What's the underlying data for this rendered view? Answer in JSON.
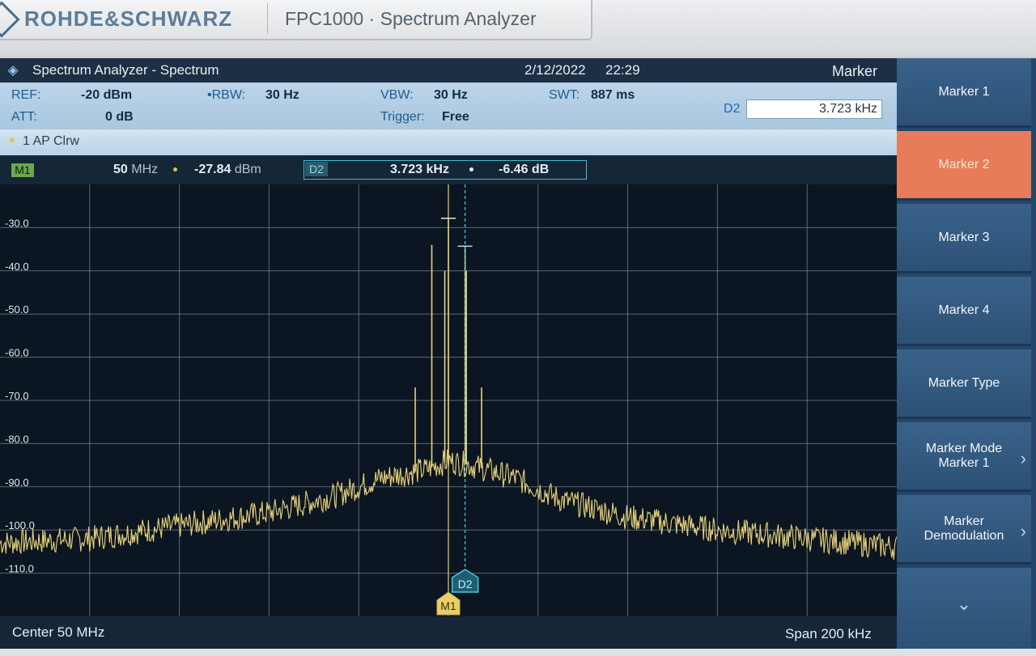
{
  "brand": {
    "name": "ROHDE&SCHWARZ",
    "model": "FPC1000 · Spectrum Analyzer"
  },
  "title_bar": {
    "icon": "rs-logo-icon",
    "title": "Spectrum Analyzer - Spectrum",
    "date": "2/12/2022",
    "time": "22:29",
    "right_title": "Marker"
  },
  "params": {
    "ref_label": "REF:",
    "ref_value": "-20 dBm",
    "att_label": "ATT:",
    "att_value": "0 dB",
    "rbw_label": "•RBW:",
    "rbw_value": "30 Hz",
    "vbw_label": "VBW:",
    "vbw_value": "30 Hz",
    "trigger_label": "Trigger:",
    "trigger_value": "Free",
    "swt_label": "SWT:",
    "swt_value": "887 ms",
    "d2_label": "D2",
    "d2_input": "3.723 kHz"
  },
  "trace": {
    "label": "1 AP Clrw"
  },
  "markers": {
    "m1_tag": "M1",
    "m1_freq": "50",
    "m1_freq_unit": "MHz",
    "m1_level": "-27.84",
    "m1_level_unit": "dBm",
    "d2_tag": "D2",
    "d2_freq": "3.723 kHz",
    "d2_level": "-6.46 dB"
  },
  "plot": {
    "y_ticks": [
      "-30.0",
      "-40.0",
      "-50.0",
      "-60.0",
      "-70.0",
      "-80.0",
      "-90.0",
      "-100.0",
      "-110.0"
    ],
    "y_values": [
      -30,
      -40,
      -50,
      -60,
      -70,
      -80,
      -90,
      -100,
      -110
    ],
    "ylim": [
      -120,
      -20
    ],
    "xlim": [
      -100,
      100
    ],
    "trace_color": "#e9d27a",
    "grid_color": "#7e8a96",
    "marker_m1": {
      "label": "M1",
      "x": 0,
      "y": -27.84,
      "color": "#e8cf6a"
    },
    "marker_d2": {
      "label": "D2",
      "x": 3.723,
      "y": -34.3,
      "color": "#4cc9dc"
    },
    "spurs": [
      {
        "x": -3.7,
        "y": -34
      },
      {
        "x": 0,
        "y": -27.84
      },
      {
        "x": 3.723,
        "y": -34.3
      },
      {
        "x": -7.4,
        "y": -67
      },
      {
        "x": 7.4,
        "y": -67
      },
      {
        "x": -0.8,
        "y": -40
      },
      {
        "x": 4.0,
        "y": -40
      }
    ],
    "noise_floor": [
      {
        "x": -100,
        "y": -103
      },
      {
        "x": -80,
        "y": -102
      },
      {
        "x": -60,
        "y": -99
      },
      {
        "x": -40,
        "y": -96
      },
      {
        "x": -25,
        "y": -92
      },
      {
        "x": -15,
        "y": -88
      },
      {
        "x": -5,
        "y": -86
      },
      {
        "x": 0,
        "y": -84
      },
      {
        "x": 5,
        "y": -85
      },
      {
        "x": 15,
        "y": -88
      },
      {
        "x": 25,
        "y": -93
      },
      {
        "x": 40,
        "y": -97
      },
      {
        "x": 60,
        "y": -100
      },
      {
        "x": 80,
        "y": -102
      },
      {
        "x": 100,
        "y": -104
      }
    ]
  },
  "bottom": {
    "center": "Center 50 MHz",
    "span": "Span 200 kHz"
  },
  "softkeys": [
    {
      "label": "Marker 1",
      "sub": "",
      "active": false,
      "chevron": false
    },
    {
      "label": "Marker 2",
      "sub": "",
      "active": true,
      "chevron": false
    },
    {
      "label": "Marker 3",
      "sub": "",
      "active": false,
      "chevron": false
    },
    {
      "label": "Marker 4",
      "sub": "",
      "active": false,
      "chevron": false
    },
    {
      "label": "Marker Type",
      "sub": "",
      "active": false,
      "chevron": false
    },
    {
      "label": "Marker Mode",
      "sub": "Marker 1",
      "active": false,
      "chevron": true
    },
    {
      "label": "Marker",
      "sub": "Demodulation",
      "active": false,
      "chevron": true
    }
  ],
  "softkey_more_icon": "chevron-down-icon"
}
